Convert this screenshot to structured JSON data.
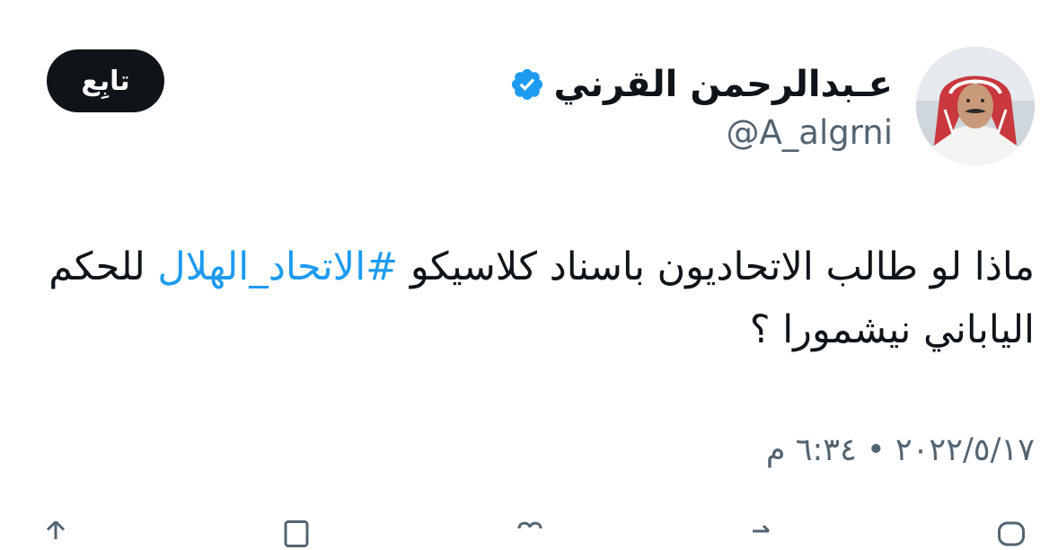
{
  "author": {
    "display_name": "عـبدالرحمن القرني",
    "handle": "@A_algrni",
    "verified": true
  },
  "follow_button": {
    "label": "تابِع"
  },
  "tweet": {
    "text_before": "ماذا لو طالب الاتحاديون باسناد كلاسيكو ",
    "hashtag": "#الاتحاد_الهلال",
    "text_after": " للحكم الياباني نيشمورا ؟",
    "timestamp": "٢٠٢٢/٥/١٧ • ٦:٣٤ م"
  },
  "colors": {
    "text": "#0f1419",
    "secondary": "#536471",
    "accent": "#1d9bf0",
    "button_bg": "#0f1419"
  },
  "icons": [
    "verified-badge-icon",
    "reply-icon",
    "retweet-icon",
    "like-icon",
    "views-icon",
    "share-icon"
  ]
}
